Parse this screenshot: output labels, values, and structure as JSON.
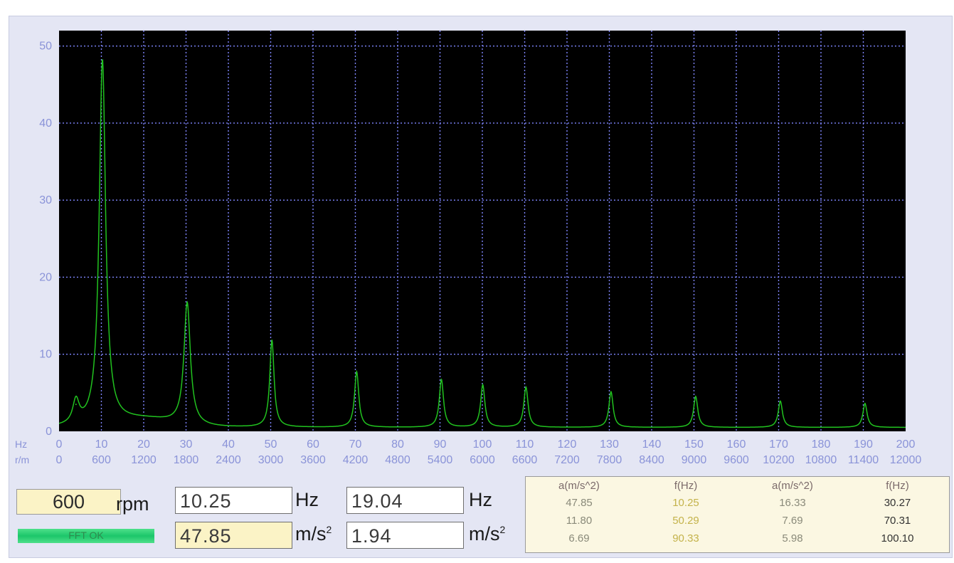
{
  "chart_data": {
    "type": "line",
    "title": "",
    "xlabel": "Hz",
    "x2label": "r/m",
    "ylabel": "",
    "xlim": [
      0,
      200
    ],
    "ylim": [
      0,
      52
    ],
    "grid": true,
    "colors": {
      "background": "#000000",
      "grid": "#7f86ff",
      "line": "#21c21f",
      "tick_text": "#8a93d8"
    },
    "y_ticks": [
      "0",
      "10",
      "20",
      "30",
      "40",
      "50"
    ],
    "x_ticks_hz": [
      "0",
      "10",
      "20",
      "30",
      "40",
      "50",
      "60",
      "70",
      "80",
      "90",
      "100",
      "110",
      "120",
      "130",
      "140",
      "150",
      "160",
      "170",
      "180",
      "190",
      "200"
    ],
    "x_ticks_rpm": [
      "0",
      "600",
      "1200",
      "1800",
      "2400",
      "3000",
      "3600",
      "4200",
      "4800",
      "5400",
      "6000",
      "6600",
      "7200",
      "7800",
      "8400",
      "9000",
      "9600",
      "10200",
      "10800",
      "11400",
      "12000"
    ],
    "series": [
      {
        "peaks": [
          {
            "x": 4.0,
            "y": 3.5
          },
          {
            "x": 10.25,
            "y": 47.85
          },
          {
            "x": 30.27,
            "y": 16.33
          },
          {
            "x": 50.29,
            "y": 11.8
          },
          {
            "x": 70.31,
            "y": 7.69
          },
          {
            "x": 90.33,
            "y": 6.69
          },
          {
            "x": 100.1,
            "y": 5.98
          },
          {
            "x": 110.3,
            "y": 5.7
          },
          {
            "x": 130.4,
            "y": 5.1
          },
          {
            "x": 150.4,
            "y": 4.5
          },
          {
            "x": 170.4,
            "y": 3.9
          },
          {
            "x": 190.4,
            "y": 3.6
          }
        ]
      }
    ]
  },
  "readout": {
    "rpm_value": "600",
    "rpm_unit": "rpm",
    "freq1": "10.25",
    "freq1_unit": "Hz",
    "freq2": "19.04",
    "freq2_unit": "Hz",
    "acc1": "47.85",
    "acc1_unit": "m/s",
    "acc1_sup": "2",
    "acc2": "1.94",
    "acc2_unit": "m/s",
    "acc2_sup": "2",
    "status": "FFT OK"
  },
  "peak_table": {
    "headers": [
      "a(m/s^2)",
      "f(Hz)",
      "a(m/s^2)",
      "f(Hz)"
    ],
    "rows": [
      [
        "47.85",
        "10.25",
        "16.33",
        "30.27"
      ],
      [
        "11.80",
        "50.29",
        "7.69",
        "70.31"
      ],
      [
        "6.69",
        "90.33",
        "5.98",
        "100.10"
      ]
    ]
  }
}
